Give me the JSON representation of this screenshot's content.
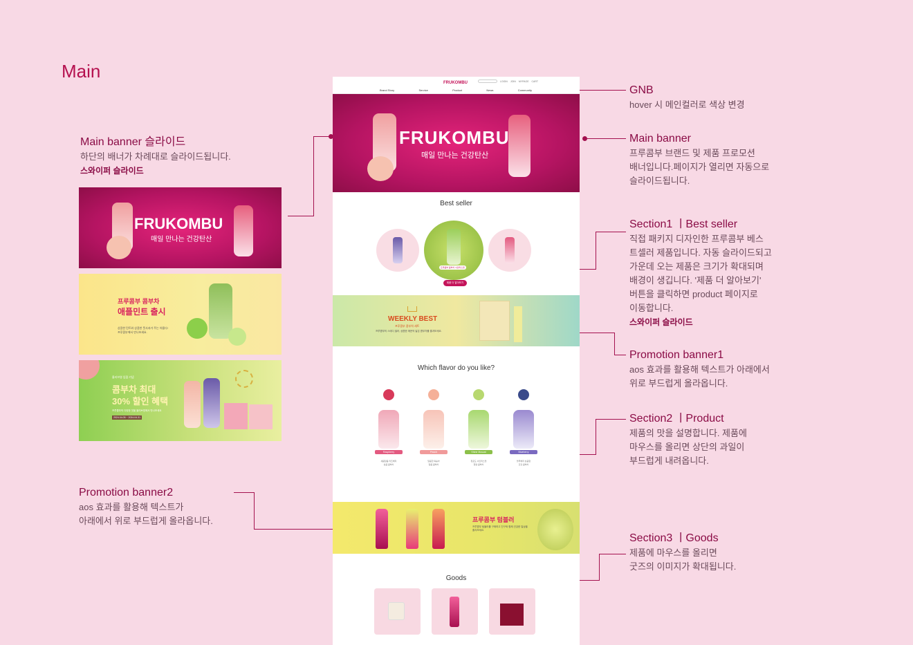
{
  "page_title": "Main",
  "annotations": {
    "main_banner_slide": {
      "title": "Main banner 슬라이드",
      "desc": "하단의 배너가 차례대로 슬라이드됩니다.",
      "note": "스와이퍼 슬라이드"
    },
    "promotion_banner2": {
      "title": "Promotion banner2",
      "desc1": "aos 효과를 활용해 텍스트가",
      "desc2": "아래에서 위로 부드럽게 올라옵니다."
    },
    "gnb": {
      "title": "GNB",
      "desc": "hover 시 메인컬러로 색상 변경"
    },
    "main_banner": {
      "title": "Main banner",
      "desc1": "프루콤부 브랜드 및 제품 프로모션",
      "desc2": "배너입니다.페이지가 열리면 자동으로",
      "desc3": "슬라이드됩니다."
    },
    "section1": {
      "title": "Section1 ㅣBest seller",
      "lines": [
        "직접 패키지 디자인한 프루콤부 베스",
        "트셀러 제품입니다. 자동 슬라이드되고",
        "가운데 오는 제품은 크기가 확대되며",
        "배경이 생깁니다. '제품 더 알아보기'",
        "버튼을 클릭하면 product 페이지로",
        "이동합니다."
      ],
      "note": "스와이퍼 슬라이드"
    },
    "promotion_banner1": {
      "title": "Promotion banner1",
      "desc1": "aos 효과를 활용해 텍스트가 아래에서",
      "desc2": "위로 부드럽게 올라옵니다."
    },
    "section2": {
      "title": "Section2 ㅣProduct",
      "desc1": "제품의 맛을 설명합니다. 제품에",
      "desc2": "마우스를 올리면 상단의 과일이",
      "desc3": "부드럽게 내려옵니다."
    },
    "section3": {
      "title": "Section3 ㅣGoods",
      "desc1": "제품에 마우스를 올리면",
      "desc2": "굿즈의 이미지가 확대됩니다."
    }
  },
  "thumbs": {
    "banner1": {
      "brand": "FRUKOMBU",
      "tagline": "매일 만나는 건강탄산"
    },
    "banner2": {
      "kicker": "프루콤부 콤부차",
      "headline": "애플민트 출시",
      "body1": "상큼한 민트와 상큼한 풋사과가 주는 아름다!",
      "body2": "프루콤부에서 만나보세요."
    },
    "banner3": {
      "kicker": "올리브영 입점 기념",
      "headline1": "콤부차 최대",
      "headline2": "30% 할인 혜택",
      "body": "프루콤부의 다양한 맛을 올리브영에서 만나보세요",
      "date": "2024.04.05 ~ 2024.04.31"
    }
  },
  "mock": {
    "logo": "FRUKOMBU",
    "topnav": [
      "LOGIN",
      "JOIN",
      "MYPAGE",
      "CART"
    ],
    "menu": [
      "Brand Story",
      "Service",
      "Product",
      "News",
      "Community"
    ],
    "hero": {
      "brand": "FRUKOMBU",
      "tagline": "매일 만나는 건강탄산"
    },
    "bestseller_title": "Best seller",
    "bestseller_button": "제품 더 알아보기",
    "bestseller_center_label": "프루콤부 콤부차 샤인머스캣",
    "promo1": {
      "title": "WEEKLY BEST",
      "sub": "프루콤부 콤부차 세트",
      "desc": "프루콤부의 스테디 셀러, 상큼한 매운의 닮은 콤부차를 즐겨보세요."
    },
    "flavor_title": "Which flavor do you like?",
    "flavors": [
      {
        "label": "Raspberry",
        "desc1": "새콤달콤 라즈베리",
        "desc2": "상큼 콤부차"
      },
      {
        "label": "Peach",
        "desc1": "달콤한 복숭아",
        "desc2": "달콤 콤부차"
      },
      {
        "label": "Shine Muscat",
        "desc1": "청포도 샤인머스캣",
        "desc2": "청량 콤부차"
      },
      {
        "label": "Blueberry",
        "desc1": "블루베리 상큼함",
        "desc2": "건강 콤부차"
      }
    ],
    "promo2": {
      "title": "프루콤부 텀블러",
      "desc": "프루콤부 텀블러를 구매하고 친구와 함께 건강한 일상을 즐겨보세요."
    },
    "goods_title": "Goods"
  },
  "colors": {
    "accent": "#a3104e",
    "bg": "#f8d9e5",
    "brand": "#c4145a"
  }
}
